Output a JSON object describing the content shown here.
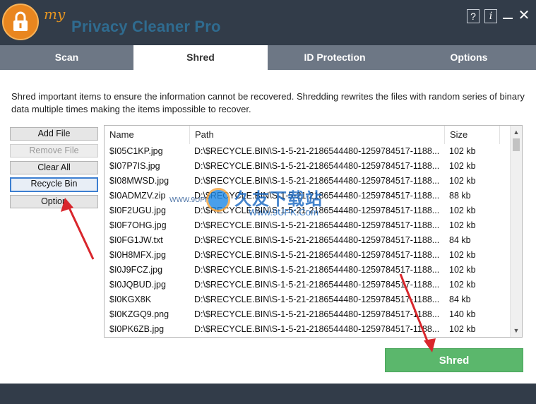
{
  "brand": {
    "prefix": "my",
    "name": "Privacy Cleaner Pro"
  },
  "window_controls": {
    "help": "?",
    "info": "i",
    "close": "✕"
  },
  "tabs": [
    {
      "label": "Scan",
      "active": false
    },
    {
      "label": "Shred",
      "active": true
    },
    {
      "label": "ID Protection",
      "active": false
    },
    {
      "label": "Options",
      "active": false
    }
  ],
  "description": "Shred important items to ensure the information cannot be recovered. Shredding rewrites the files with random series of binary data multiple times making the items impossible to recover.",
  "side_buttons": {
    "add_file": "Add File",
    "remove_file": "Remove File",
    "clear_all": "Clear All",
    "recycle_bin": "Recycle Bin",
    "option": "Option"
  },
  "list": {
    "columns": {
      "name": "Name",
      "path": "Path",
      "size": "Size"
    },
    "rows": [
      {
        "name": "$I05C1KP.jpg",
        "path": "D:\\$RECYCLE.BIN\\S-1-5-21-2186544480-1259784517-1188...",
        "size": "102 kb"
      },
      {
        "name": "$I07P7IS.jpg",
        "path": "D:\\$RECYCLE.BIN\\S-1-5-21-2186544480-1259784517-1188...",
        "size": "102 kb"
      },
      {
        "name": "$I08MWSD.jpg",
        "path": "D:\\$RECYCLE.BIN\\S-1-5-21-2186544480-1259784517-1188...",
        "size": "102 kb"
      },
      {
        "name": "$I0ADMZV.zip",
        "path": "D:\\$RECYCLE.BIN\\S-1-5-21-2186544480-1259784517-1188...",
        "size": "88 kb"
      },
      {
        "name": "$I0F2UGU.jpg",
        "path": "D:\\$RECYCLE.BIN\\S-1-5-21-2186544480-1259784517-1188...",
        "size": "102 kb"
      },
      {
        "name": "$I0F7OHG.jpg",
        "path": "D:\\$RECYCLE.BIN\\S-1-5-21-2186544480-1259784517-1188...",
        "size": "102 kb"
      },
      {
        "name": "$I0FG1JW.txt",
        "path": "D:\\$RECYCLE.BIN\\S-1-5-21-2186544480-1259784517-1188...",
        "size": "84 kb"
      },
      {
        "name": "$I0H8MFX.jpg",
        "path": "D:\\$RECYCLE.BIN\\S-1-5-21-2186544480-1259784517-1188...",
        "size": "102 kb"
      },
      {
        "name": "$I0J9FCZ.jpg",
        "path": "D:\\$RECYCLE.BIN\\S-1-5-21-2186544480-1259784517-1188...",
        "size": "102 kb"
      },
      {
        "name": "$I0JQBUD.jpg",
        "path": "D:\\$RECYCLE.BIN\\S-1-5-21-2186544480-1259784517-1188...",
        "size": "102 kb"
      },
      {
        "name": "$I0KGX8K",
        "path": "D:\\$RECYCLE.BIN\\S-1-5-21-2186544480-1259784517-1188...",
        "size": "84 kb"
      },
      {
        "name": "$I0KZGQ9.png",
        "path": "D:\\$RECYCLE.BIN\\S-1-5-21-2186544480-1259784517-1188...",
        "size": "140 kb"
      },
      {
        "name": "$I0PK6ZB.jpg",
        "path": "D:\\$RECYCLE.BIN\\S-1-5-21-2186544480-1259784517-1188...",
        "size": "102 kb"
      }
    ]
  },
  "shred_button": "Shred",
  "watermark": {
    "text_cn": "久友下载站",
    "url": "Www.9UPK.Com",
    "small": "WWW.9UPK.COM"
  },
  "colors": {
    "titlebar": "#323c49",
    "tabbar": "#6d7785",
    "accent_orange": "#e9861f",
    "shred_green": "#5bb76c",
    "annotation_red": "#d9262c"
  },
  "icons": {
    "logo": "padlock-icon",
    "minimize": "minimize-icon",
    "close": "close-icon"
  }
}
